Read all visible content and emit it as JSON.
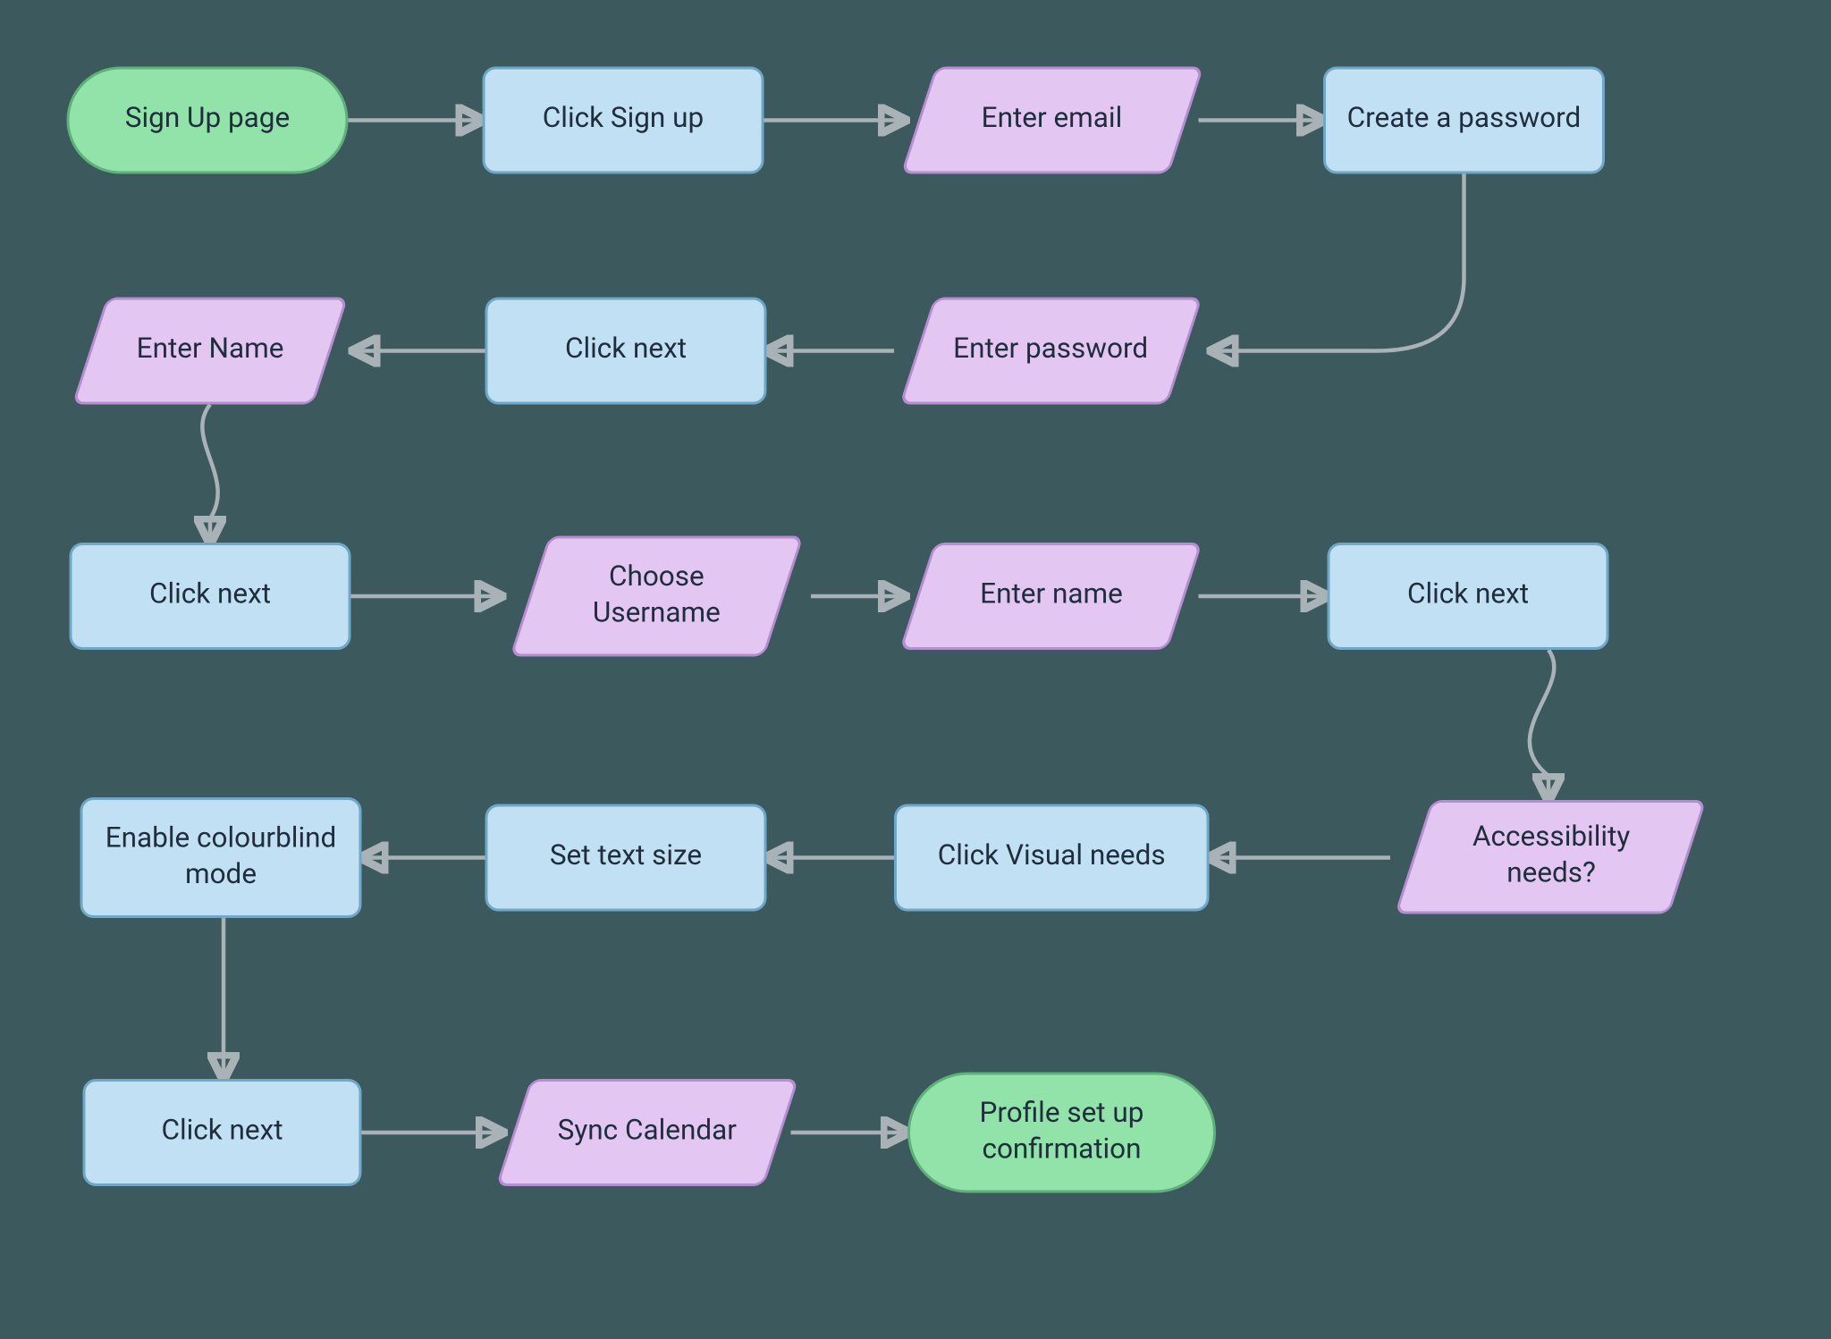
{
  "chart_data": {
    "type": "flowchart",
    "title": "",
    "nodes": [
      {
        "id": "n1",
        "shape": "terminator",
        "label": "Sign Up page"
      },
      {
        "id": "n2",
        "shape": "process",
        "label": "Click Sign up"
      },
      {
        "id": "n3",
        "shape": "io",
        "label": "Enter email"
      },
      {
        "id": "n4",
        "shape": "process",
        "label": "Create a password"
      },
      {
        "id": "n5",
        "shape": "io",
        "label": "Enter password"
      },
      {
        "id": "n6",
        "shape": "process",
        "label": "Click next"
      },
      {
        "id": "n7",
        "shape": "io",
        "label": "Enter Name"
      },
      {
        "id": "n8",
        "shape": "process",
        "label": "Click next"
      },
      {
        "id": "n9",
        "shape": "io",
        "label": "Choose Username"
      },
      {
        "id": "n10",
        "shape": "io",
        "label": "Enter name"
      },
      {
        "id": "n11",
        "shape": "process",
        "label": "Click next"
      },
      {
        "id": "n12",
        "shape": "io",
        "label": "Accessibility needs?"
      },
      {
        "id": "n13",
        "shape": "process",
        "label": "Click Visual needs"
      },
      {
        "id": "n14",
        "shape": "process",
        "label": "Set text size"
      },
      {
        "id": "n15",
        "shape": "process",
        "label": "Enable colourblind mode"
      },
      {
        "id": "n16",
        "shape": "process",
        "label": "Click next"
      },
      {
        "id": "n17",
        "shape": "io",
        "label": "Sync Calendar"
      },
      {
        "id": "n18",
        "shape": "terminator",
        "label": "Profile set up confirmation"
      }
    ],
    "edges": [
      {
        "from": "n1",
        "to": "n2"
      },
      {
        "from": "n2",
        "to": "n3"
      },
      {
        "from": "n3",
        "to": "n4"
      },
      {
        "from": "n4",
        "to": "n5"
      },
      {
        "from": "n5",
        "to": "n6"
      },
      {
        "from": "n6",
        "to": "n7"
      },
      {
        "from": "n7",
        "to": "n8"
      },
      {
        "from": "n8",
        "to": "n9"
      },
      {
        "from": "n9",
        "to": "n10"
      },
      {
        "from": "n10",
        "to": "n11"
      },
      {
        "from": "n11",
        "to": "n12"
      },
      {
        "from": "n12",
        "to": "n13"
      },
      {
        "from": "n13",
        "to": "n14"
      },
      {
        "from": "n14",
        "to": "n15"
      },
      {
        "from": "n15",
        "to": "n16"
      },
      {
        "from": "n16",
        "to": "n17"
      },
      {
        "from": "n17",
        "to": "n18"
      }
    ]
  },
  "colors": {
    "terminator": "#92e3a9",
    "process": "#c2e0f4",
    "io": "#e3c7f2",
    "edge": "#a9b2b7",
    "background": "#3c5a5d"
  }
}
